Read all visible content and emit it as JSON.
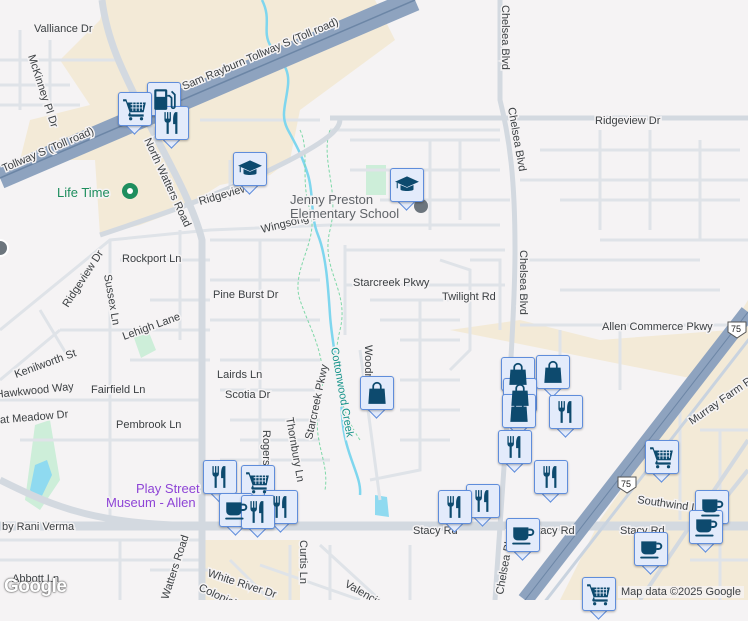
{
  "map": {
    "roads": {
      "tollway_upper": "Sam Rayburn Tollway S (Toll road)",
      "tollway_lower": "Tollway S (Toll road)",
      "north_watters": "North Watters Road",
      "north_watters_lower": "Watters Road",
      "valliance": "Valliance Dr",
      "mckinney": "McKinney Pl Dr",
      "ridgeview_top": "Ridgeview Dr",
      "ridgeview_mid": "Ridgeview",
      "ridgeview_left": "Ridgeview Dr",
      "chelsea_top": "Chelsea Blvd",
      "chelsea_mid": "Chelsea Blvd",
      "chelsea_right": "Chelsea Blvd",
      "chelsea_bottom": "Chelsea Blvd",
      "wingsong": "Wingsong Ln",
      "rockport": "Rockport Ln",
      "sussex": "Sussex Ln",
      "pine_burst": "Pine Burst Dr",
      "starcreek": "Starcreek Pkwy",
      "starcreek_vertical": "Starcreek Pkwy",
      "twilight": "Twilight Rd",
      "allen_commerce": "Allen Commerce Pkwy",
      "lehigh": "Lehigh Lane",
      "kenilworth": "Kenilworth St",
      "hawkwood": "Hawkwood Way",
      "fairfield": "Fairfield Ln",
      "meadow": "Great Meadow Dr",
      "pembrook": "Pembrook Ln",
      "lairds": "Lairds Ln",
      "scotia": "Scotia Dr",
      "thornbury": "Thornbury Ln",
      "rogers": "Rogers Dr",
      "woodrock": "Woodrock Dr",
      "curtis": "Curtis Ln",
      "stacy_left": "Stacy Rd",
      "stacy_mid": "Stacy Rd",
      "stacy_right": "Stacy Rd",
      "abbott": "Abbott Ln",
      "white_river": "White River Dr",
      "colonial": "Colonial",
      "valencia": "Valencia",
      "murray": "Murray Farm Rd",
      "southwind": "Southwind Ln",
      "rani": "by Rani Verma",
      "creek": "Cottonwood Creek",
      "us75": "75"
    },
    "places": {
      "lifetime": "Life Time",
      "school_line1": "Jenny Preston",
      "school_line2": "Elementary School",
      "museum_line1": "Play Street",
      "museum_line2": "Museum - Allen"
    },
    "markers": [
      "shopping-cart",
      "fuel",
      "restaurant",
      "school",
      "school",
      "shopping-bag",
      "shopping-bag",
      "shopping-bag",
      "shopping-bag",
      "restaurant",
      "restaurant",
      "restaurant",
      "restaurant",
      "shopping-cart",
      "coffee",
      "restaurant",
      "restaurant",
      "restaurant",
      "restaurant",
      "coffee",
      "shopping-cart",
      "coffee",
      "coffee",
      "coffee",
      "shopping-cart"
    ],
    "colors": {
      "marker_fill": "#e3ebfb",
      "marker_border": "#5f8ddb",
      "icon": "#0d4a6e",
      "highway": "#8ea3bf",
      "creek": "#7fd6ee",
      "commercial": "#f3ead7",
      "park": "#cdeed9"
    },
    "attribution": "Map data ©2025 Google",
    "logo": "Google"
  }
}
